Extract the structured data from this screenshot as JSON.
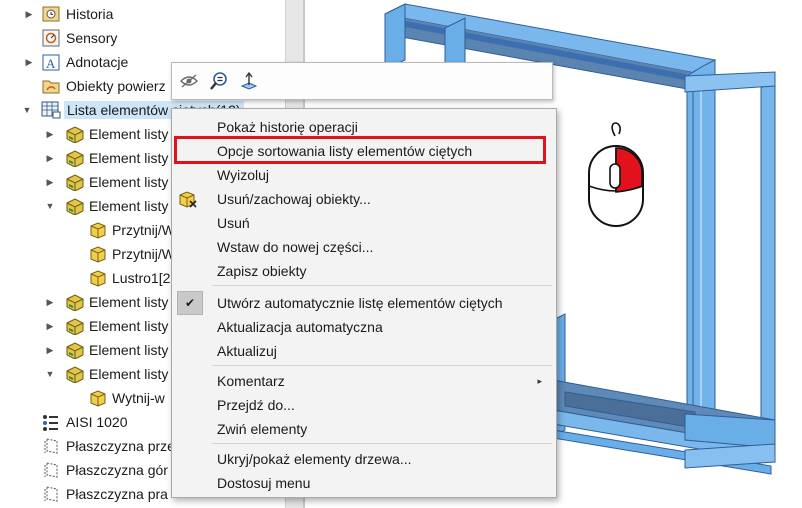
{
  "tree": {
    "items": [
      {
        "label": "Historia",
        "arrow": "▶"
      },
      {
        "label": "Sensory",
        "arrow": ""
      },
      {
        "label": "Adnotacje",
        "arrow": "▶"
      },
      {
        "label": "Obiekty powierz",
        "arrow": ""
      },
      {
        "label": "Lista elementów ciętych(12)",
        "arrow": "▼"
      },
      {
        "label": "Element listy",
        "arrow": "▶"
      },
      {
        "label": "Element listy",
        "arrow": "▶"
      },
      {
        "label": "Element listy",
        "arrow": "▶"
      },
      {
        "label": "Element listy",
        "arrow": "▼"
      },
      {
        "label": "Przytnij/W",
        "arrow": ""
      },
      {
        "label": "Przytnij/W",
        "arrow": ""
      },
      {
        "label": "Lustro1[2",
        "arrow": ""
      },
      {
        "label": "Element listy",
        "arrow": "▶"
      },
      {
        "label": "Element listy",
        "arrow": "▶"
      },
      {
        "label": "Element listy",
        "arrow": "▶"
      },
      {
        "label": "Element listy",
        "arrow": "▼"
      },
      {
        "label": "Wytnij-w",
        "arrow": ""
      },
      {
        "label": "AISI 1020",
        "arrow": ""
      },
      {
        "label": "Płaszczyzna prze",
        "arrow": ""
      },
      {
        "label": "Płaszczyzna gór",
        "arrow": ""
      },
      {
        "label": "Płaszczyzna pra",
        "arrow": ""
      }
    ]
  },
  "toolbar": {
    "buttons": [
      "hide-icon",
      "zoom-to-selection-icon",
      "normal-to-icon"
    ]
  },
  "menu": {
    "items": [
      {
        "label": "Pokaż historię operacji"
      },
      {
        "label": "Opcje sortowania listy elementów ciętych"
      },
      {
        "label": "Wyizoluj"
      },
      {
        "label": "Usuń/zachowaj obiekty..."
      },
      {
        "label": "Usuń"
      },
      {
        "label": "Wstaw do nowej części..."
      },
      {
        "label": "Zapisz obiekty"
      },
      {
        "label": "Utwórz automatycznie listę elementów ciętych",
        "checked": true
      },
      {
        "label": "Aktualizacja automatyczna"
      },
      {
        "label": "Aktualizuj"
      },
      {
        "label": "Komentarz",
        "submenu": "▸"
      },
      {
        "label": "Przejdź do..."
      },
      {
        "label": "Zwiń elementy"
      },
      {
        "label": "Ukryj/pokaż elementy drzewa..."
      },
      {
        "label": "Dostosuj menu"
      }
    ]
  },
  "colors": {
    "highlight": "#e3111b",
    "frame": "#4a9de0",
    "mouse_button": "#e3111b"
  }
}
